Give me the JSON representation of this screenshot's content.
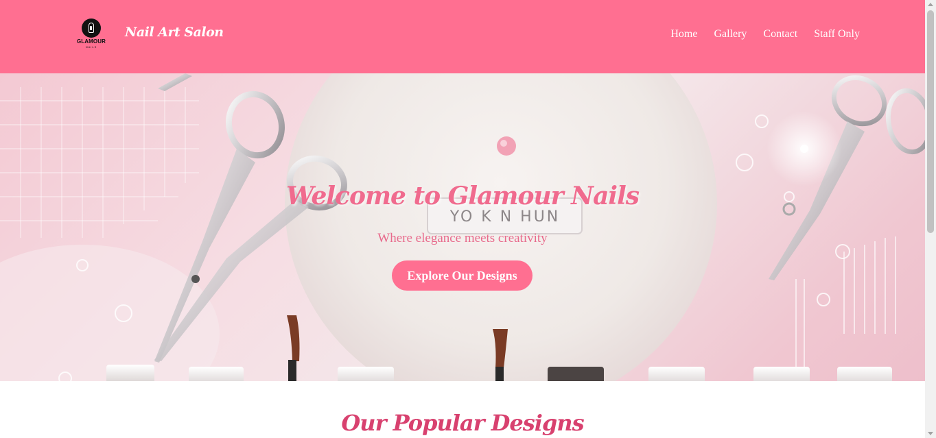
{
  "header": {
    "logo": {
      "name": "GLAMOUR",
      "sub": "NAILS"
    },
    "brand_title": "Nail Art Salon",
    "nav": [
      "Home",
      "Gallery",
      "Contact",
      "Staff Only"
    ]
  },
  "hero": {
    "title": "Welcome to Glamour Nails",
    "subtitle": "Where elegance meets creativity",
    "button_label": "Explore Our Designs",
    "card_text": "YO K N HUN"
  },
  "section": {
    "title": "Our Popular Designs"
  },
  "colors": {
    "header_bg": "#ff6f91",
    "accent": "#ff6f91",
    "title_pink": "#f06b8e",
    "section_title": "#d8416f"
  }
}
